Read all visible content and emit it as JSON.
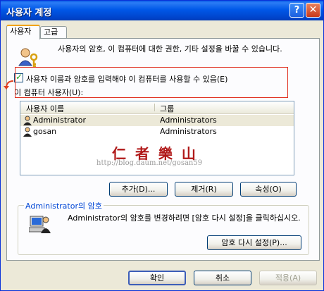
{
  "window": {
    "title": "사용자 계정"
  },
  "titlebar": {
    "help": "?",
    "close": "✕"
  },
  "tabs": [
    {
      "label": "사용자"
    },
    {
      "label": "고급"
    }
  ],
  "users_tab": {
    "description": "사용자의 암호, 이 컴퓨터에 대한  권한, 기타 설정을 바꿀 수 있습니다.",
    "checkbox_label": "사용자 이름과 암호를 입력해야 이 컴퓨터를 사용할 수 있음(E)",
    "checkbox_checked": true,
    "users_label": "이 컴퓨터 사용자(U):",
    "columns": [
      "사용자 이름",
      "그룹"
    ],
    "rows": [
      {
        "name": "Administrator",
        "group": "Administrators"
      },
      {
        "name": "gosan",
        "group": "Administrators"
      }
    ],
    "watermark": "仁 者 樂 山",
    "watermark_url": "http://blog.daum.net/gosan59",
    "buttons": {
      "add": "추가(D)...",
      "remove": "제거(R)",
      "properties": "속성(O)"
    },
    "password_group": {
      "title": "Administrator의 암호",
      "description": "Administrator의 암호를 변경하려면 [암호 다시 설정]을 클릭하십시오.",
      "reset_button": "암호 다시 설정(P)..."
    }
  },
  "footer": {
    "ok": "확인",
    "cancel": "취소",
    "apply": "적용(A)"
  }
}
